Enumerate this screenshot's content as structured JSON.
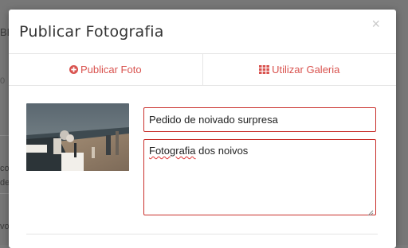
{
  "background": {
    "fragments": [
      "BE",
      "0",
      "co",
      "de",
      "vo"
    ]
  },
  "modal": {
    "title": "Publicar Fotografia",
    "close_glyph": "×",
    "tabs": [
      {
        "label": "Publicar Foto",
        "icon": "plus-circle-icon"
      },
      {
        "label": "Utilizar Galeria",
        "icon": "grid-icon"
      }
    ],
    "form": {
      "title_value": "Pedido de noivado surpresa",
      "description_word1": "Fotografia",
      "description_rest": " dos noivos"
    }
  },
  "colors": {
    "accent": "#d9534f",
    "error_border": "#c9302c",
    "overlay": "#777777"
  }
}
